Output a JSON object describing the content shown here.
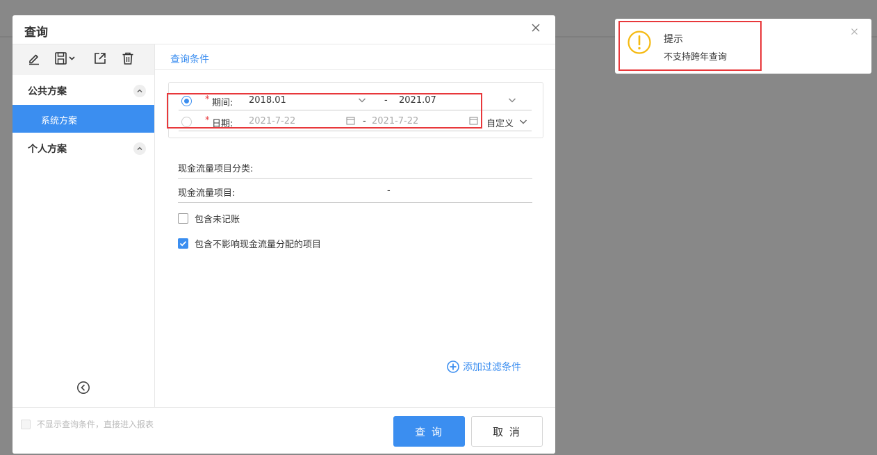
{
  "dialog": {
    "title": "查询"
  },
  "sidebar": {
    "groups": [
      {
        "label": "公共方案",
        "items": [
          {
            "label": "系统方案",
            "selected": true
          }
        ]
      },
      {
        "label": "个人方案",
        "items": []
      }
    ],
    "toolbar_icons": [
      "edit-icon",
      "save-icon",
      "export-icon",
      "delete-icon"
    ]
  },
  "main": {
    "tab_label": "查询条件",
    "period": {
      "required_mark": "*",
      "label": "期间:",
      "start": "2018.01",
      "separator": "-",
      "end": "2021.07",
      "selected": true
    },
    "date": {
      "required_mark": "*",
      "label": "日期:",
      "start": "2021-7-22",
      "separator": "-",
      "end": "2021-7-22",
      "mode": "自定义",
      "selected": false
    },
    "fields": [
      {
        "label": "现金流量项目分类:",
        "value": ""
      },
      {
        "label": "现金流量项目:",
        "value": "-"
      }
    ],
    "checkboxes": [
      {
        "label": "包含未记账",
        "checked": false
      },
      {
        "label": "包含不影响现金流量分配的项目",
        "checked": true
      }
    ],
    "add_filter": "添加过滤条件"
  },
  "footer": {
    "skip_label": "不显示查询条件，直接进入报表",
    "skip_checked": false,
    "query_button": "查 询",
    "cancel_button": "取 消"
  },
  "toast": {
    "title": "提示",
    "message": "不支持跨年查询",
    "icon": "warning-icon"
  },
  "colors": {
    "accent": "#3b8ef0",
    "highlight": "#e8383b",
    "warning": "#f5b90f",
    "backdrop": "#888888"
  }
}
